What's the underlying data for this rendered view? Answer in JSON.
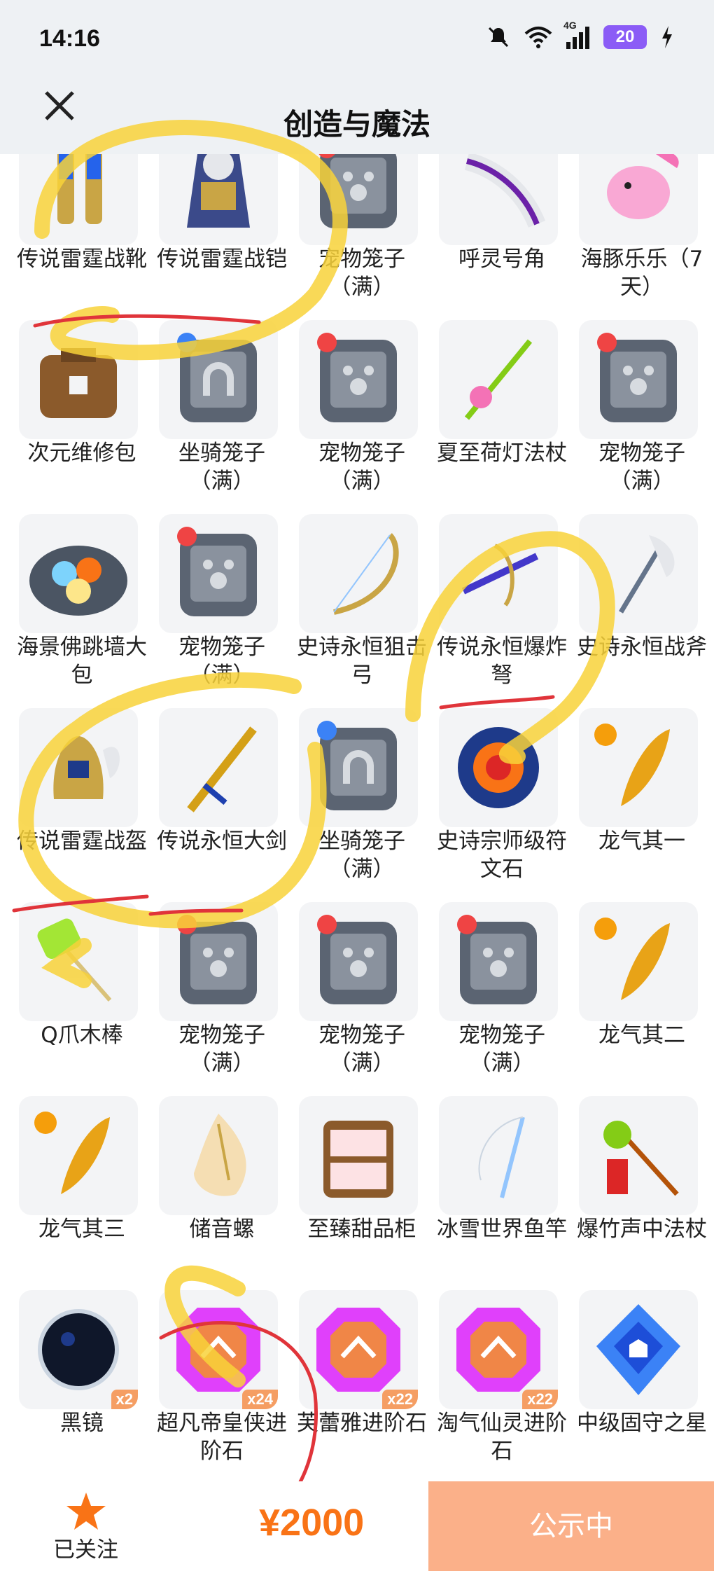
{
  "status": {
    "time": "14:16",
    "battery": "20",
    "network": "4G"
  },
  "header": {
    "title": "创造与魔法"
  },
  "items": [
    {
      "label": "传说雷霆战靴",
      "icon": "boots-icon",
      "badge": ""
    },
    {
      "label": "传说雷霆战铠",
      "icon": "armor-icon",
      "badge": ""
    },
    {
      "label": "宠物笼子（满）",
      "icon": "pet-cage-icon",
      "badge": ""
    },
    {
      "label": "呼灵号角",
      "icon": "horn-icon",
      "badge": ""
    },
    {
      "label": "海豚乐乐（7天）",
      "icon": "dolphin-icon",
      "badge": ""
    },
    {
      "label": "次元维修包",
      "icon": "repair-bag-icon",
      "badge": ""
    },
    {
      "label": "坐骑笼子（满）",
      "icon": "mount-cage-icon",
      "badge": ""
    },
    {
      "label": "宠物笼子（满）",
      "icon": "pet-cage-icon",
      "badge": ""
    },
    {
      "label": "夏至荷灯法杖",
      "icon": "staff-icon",
      "badge": ""
    },
    {
      "label": "宠物笼子（满）",
      "icon": "pet-cage-icon",
      "badge": ""
    },
    {
      "label": "海景佛跳墙大包",
      "icon": "food-plate-icon",
      "badge": ""
    },
    {
      "label": "宠物笼子（满）",
      "icon": "pet-cage-icon",
      "badge": ""
    },
    {
      "label": "史诗永恒狙击弓",
      "icon": "bow-icon",
      "badge": ""
    },
    {
      "label": "传说永恒爆炸弩",
      "icon": "crossbow-icon",
      "badge": ""
    },
    {
      "label": "史诗永恒战斧",
      "icon": "axe-icon",
      "badge": ""
    },
    {
      "label": "传说雷霆战盔",
      "icon": "helmet-icon",
      "badge": ""
    },
    {
      "label": "传说永恒大剑",
      "icon": "sword-icon",
      "badge": ""
    },
    {
      "label": "坐骑笼子（满）",
      "icon": "mount-cage-icon",
      "badge": ""
    },
    {
      "label": "史诗宗师级符文石",
      "icon": "rune-stone-icon",
      "badge": ""
    },
    {
      "label": "龙气其一",
      "icon": "dragon-qi-icon",
      "badge": ""
    },
    {
      "label": "Q爪木棒",
      "icon": "hammer-icon",
      "badge": ""
    },
    {
      "label": "宠物笼子（满）",
      "icon": "pet-cage-icon",
      "badge": ""
    },
    {
      "label": "宠物笼子（满）",
      "icon": "pet-cage-icon",
      "badge": ""
    },
    {
      "label": "宠物笼子（满）",
      "icon": "pet-cage-icon",
      "badge": ""
    },
    {
      "label": "龙气其二",
      "icon": "dragon-qi-icon",
      "badge": ""
    },
    {
      "label": "龙气其三",
      "icon": "dragon-qi-icon",
      "badge": ""
    },
    {
      "label": "储音螺",
      "icon": "conch-icon",
      "badge": ""
    },
    {
      "label": "至臻甜品柜",
      "icon": "dessert-cabinet-icon",
      "badge": ""
    },
    {
      "label": "冰雪世界鱼竿",
      "icon": "fishing-rod-icon",
      "badge": ""
    },
    {
      "label": "爆竹声中法杖",
      "icon": "firecracker-staff-icon",
      "badge": ""
    },
    {
      "label": "黑镜",
      "icon": "black-mirror-icon",
      "badge": "x2"
    },
    {
      "label": "超凡帝皇侠进阶石",
      "icon": "advance-stone-icon",
      "badge": "x24"
    },
    {
      "label": "芙蕾雅进阶石",
      "icon": "advance-stone-icon",
      "badge": "x22"
    },
    {
      "label": "淘气仙灵进阶石",
      "icon": "advance-stone-icon",
      "badge": "x22"
    },
    {
      "label": "中级固守之星",
      "icon": "shield-star-icon",
      "badge": ""
    }
  ],
  "bottom": {
    "follow_label": "已关注",
    "price": "¥2000",
    "status_button": "公示中"
  },
  "colors": {
    "accent": "#f97316",
    "button": "#fbb089",
    "annotation_yellow": "#f8d23a",
    "annotation_red": "#e0343a"
  }
}
